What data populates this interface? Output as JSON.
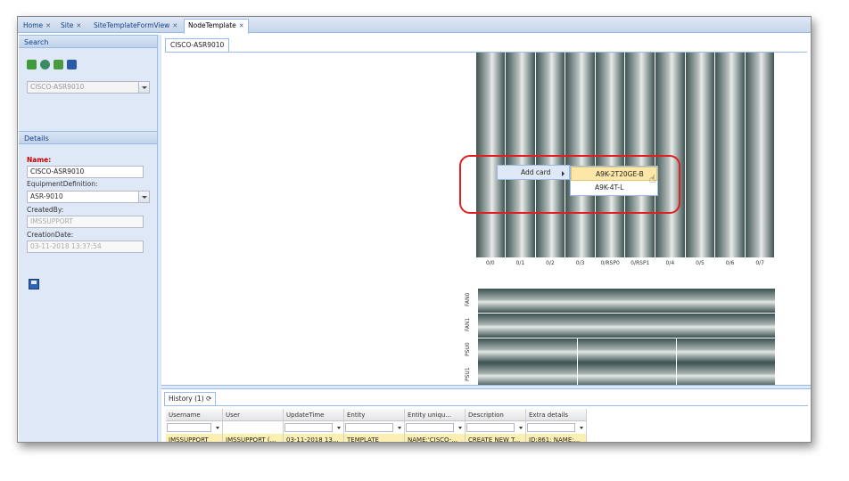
{
  "tabs": [
    {
      "label": "Home",
      "close": "✕"
    },
    {
      "label": "Site",
      "close": "✕"
    },
    {
      "label": "SiteTemplateFormView",
      "close": "✕"
    },
    {
      "label": "NodeTemplate",
      "close": "✕"
    }
  ],
  "search": {
    "title": "Search",
    "icons": [
      "refresh-icon",
      "view-icon",
      "export-icon",
      "binoculars-icon"
    ],
    "combo_value": "CISCO-ASR9010"
  },
  "details": {
    "title": "Details",
    "name_label": "Name:",
    "name_value": "CISCO-ASR9010",
    "equip_label": "EquipmentDefinition:",
    "equip_value": "ASR-9010",
    "created_by_label": "CreatedBy:",
    "created_by_value": "IMSSUPPORT",
    "creation_date_label": "CreationDate:",
    "creation_date_value": "03-11-2018 13:37:54"
  },
  "main": {
    "subtab": "CISCO-ASR9010",
    "slots": [
      "0/0",
      "0/1",
      "0/2",
      "0/3",
      "0/RSP0",
      "0/RSP1",
      "0/4",
      "0/5",
      "0/6",
      "0/7"
    ],
    "fans": [
      "FAN0",
      "FAN1"
    ],
    "psus": [
      "PSU0",
      "PSU1"
    ],
    "context_menu": {
      "item": "Add card",
      "submenu": [
        "A9K-2T20GE-B",
        "A9K-4T-L"
      ]
    }
  },
  "history": {
    "tab": "History (1)",
    "refresh_icon": "refresh-icon",
    "columns": [
      "Username",
      "User",
      "UpdateTime",
      "Entity",
      "Entity uniqu...",
      "Description",
      "Extra details"
    ],
    "rows": [
      [
        "IMSSUPPORT",
        "IMSSUPPORT (...",
        "03-11-2018 13...",
        "TEMPLATE",
        "NAME:'CISCO-...",
        "CREATE NEW T...",
        "ID:861; NAME:..."
      ]
    ]
  },
  "colors": {
    "accent": "#99bbe8",
    "highlight": "#fce7a8",
    "annotation": "#e02020"
  }
}
